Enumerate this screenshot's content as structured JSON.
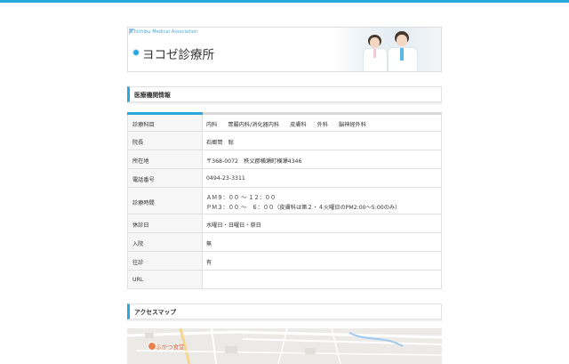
{
  "header": {
    "brand": "Chichibu Medical Association",
    "clinic_name": "ヨコゼ診療所"
  },
  "sections": {
    "info_title": "医療機関情報",
    "map_title": "アクセスマップ"
  },
  "info": {
    "rows": [
      {
        "label": "診療科目",
        "departments": [
          "内科",
          "胃腸内科/消化器内科",
          "皮膚科",
          "外科",
          "脳神経外科"
        ]
      },
      {
        "label": "院長",
        "value": "石郷岡　聡"
      },
      {
        "label": "所在地",
        "value": "〒368-0072　秩父郡横瀬町横瀬4346"
      },
      {
        "label": "電話番号",
        "value": "0494-23-3311"
      },
      {
        "label": "診療時間",
        "line1": "ＡＭ９：００ ～ １２：００",
        "line2": "ＰＭ３：００ ～　６：００（皮膚科は第２・４火曜日のPM2:00～5:00のみ）"
      },
      {
        "label": "休診日",
        "value": "水曜日・日曜日・祭日"
      },
      {
        "label": "入院",
        "value": "無"
      },
      {
        "label": "往診",
        "value": "有"
      },
      {
        "label": "URL",
        "value": ""
      }
    ]
  },
  "map": {
    "place_label": "ふかつ食堂"
  },
  "colors": {
    "accent": "#29a8e0",
    "border": "#e0e0e0",
    "label_bg": "#f6f6f6"
  }
}
